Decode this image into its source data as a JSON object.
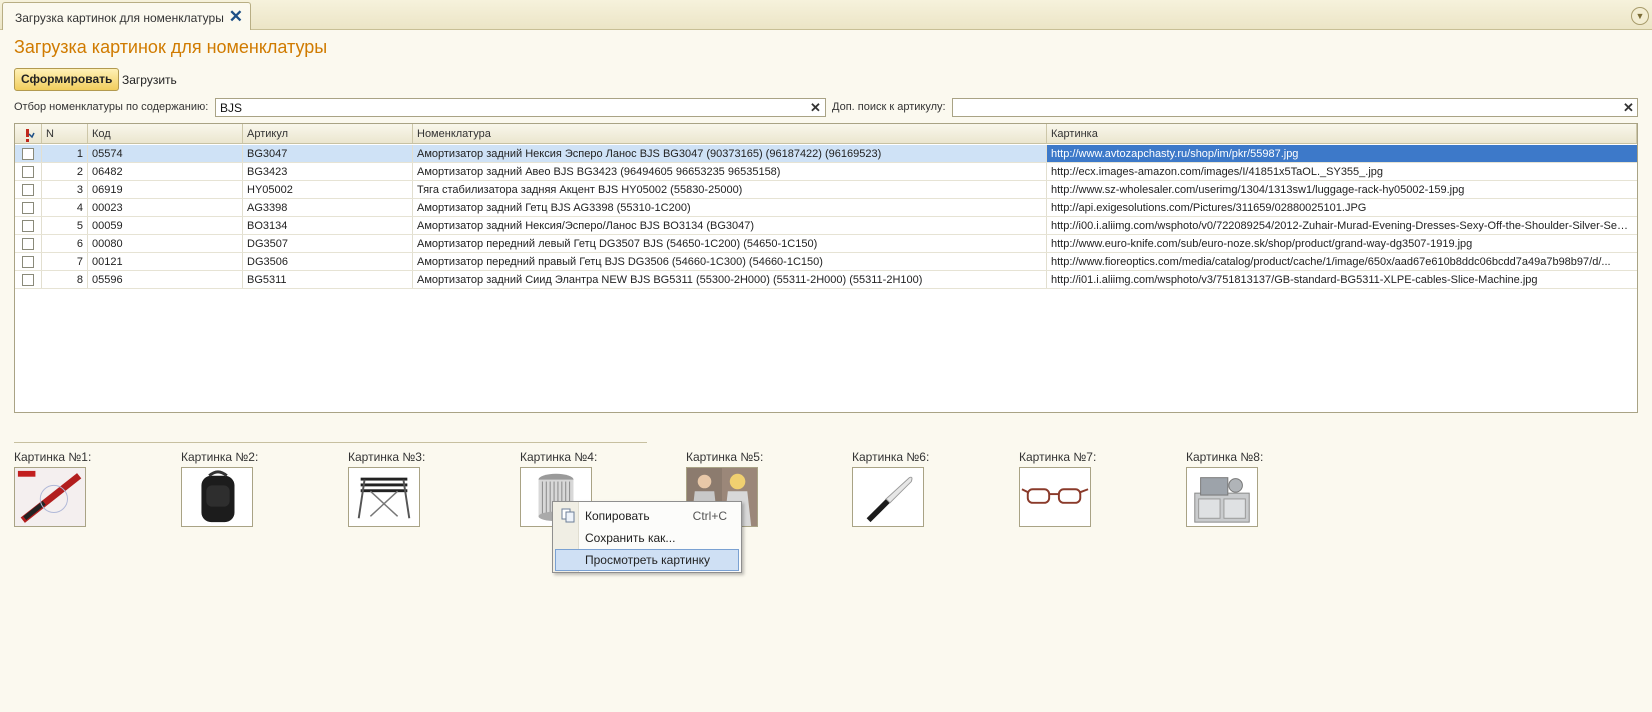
{
  "tab": {
    "title": "Загрузка картинок для номенклатуры"
  },
  "page": {
    "title": "Загрузка картинок для номенклатуры"
  },
  "toolbar": {
    "form_label": "Сформировать",
    "load_label": "Загрузить"
  },
  "filter": {
    "content_label": "Отбор номенклатуры по содержанию:",
    "content_value": "BJS",
    "article_label": "Доп. поиск к артикулу:",
    "article_value": ""
  },
  "table": {
    "columns": {
      "n": "N",
      "kod": "Код",
      "art": "Артикул",
      "nom": "Номенклатура",
      "img": "Картинка"
    },
    "rows": [
      {
        "n": "1",
        "kod": "05574",
        "art": "BG3047",
        "nom": "Амортизатор задний Нексия Эсперо Ланос BJS BG3047 (90373165) (96187422) (96169523)",
        "img": "http://www.avtozapchasty.ru/shop/im/pkr/55987.jpg"
      },
      {
        "n": "2",
        "kod": "06482",
        "art": "BG3423",
        "nom": "Амортизатор задний Авео BJS BG3423 (96494605 96653235 96535158)",
        "img": "http://ecx.images-amazon.com/images/I/41851x5TaOL._SY355_.jpg"
      },
      {
        "n": "3",
        "kod": "06919",
        "art": "HY05002",
        "nom": "Тяга стабилизатора задняя Акцент BJS HY05002 (55830-25000)",
        "img": "http://www.sz-wholesaler.com/userimg/1304/1313sw1/luggage-rack-hy05002-159.jpg"
      },
      {
        "n": "4",
        "kod": "00023",
        "art": "AG3398",
        "nom": "Амортизатор задний Гетц BJS AG3398 (55310-1C200)",
        "img": "http://api.exigesolutions.com/Pictures/311659/02880025101.JPG"
      },
      {
        "n": "5",
        "kod": "00059",
        "art": "BO3134",
        "nom": "Амортизатор задний Нексия/Эсперо/Ланос BJS BO3134 (BG3047)",
        "img": "http://i00.i.aliimg.com/wsphoto/v0/722089254/2012-Zuhair-Murad-Evening-Dresses-Sexy-Off-the-Shoulder-Silver-Sequi..."
      },
      {
        "n": "6",
        "kod": "00080",
        "art": "DG3507",
        "nom": "Амортизатор передний левый Гетц DG3507 BJS (54650-1C200) (54650-1C150)",
        "img": "http://www.euro-knife.com/sub/euro-noze.sk/shop/product/grand-way-dg3507-1919.jpg"
      },
      {
        "n": "7",
        "kod": "00121",
        "art": "DG3506",
        "nom": "Амортизатор передний правый Гетц BJS DG3506 (54660-1C300) (54660-1C150)",
        "img": "http://www.fioreoptics.com/media/catalog/product/cache/1/image/650x/aad67e610b8ddc06bcdd7a49a7b98b97/d/..."
      },
      {
        "n": "8",
        "kod": "05596",
        "art": "BG5311",
        "nom": "Амортизатор задний Сиид Элантра NEW BJS BG5311 (55300-2H000) (55311-2H000) (55311-2H100)",
        "img": "http://i01.i.aliimg.com/wsphoto/v3/751813137/GB-standard-BG5311-XLPE-cables-Slice-Machine.jpg"
      }
    ]
  },
  "pictures": [
    {
      "label": "Картинка №1:",
      "icon": "pen-image"
    },
    {
      "label": "Картинка №2:",
      "icon": "backpack-image"
    },
    {
      "label": "Картинка №3:",
      "icon": "luggage-rack-image"
    },
    {
      "label": "Картинка №4:",
      "icon": "filter-image"
    },
    {
      "label": "Картинка №5:",
      "icon": "dress-photo-image"
    },
    {
      "label": "Картинка №6:",
      "icon": "knife-image"
    },
    {
      "label": "Картинка №7:",
      "icon": "glasses-image"
    },
    {
      "label": "Картинка №8:",
      "icon": "machine-image"
    }
  ],
  "context_menu": {
    "copy": {
      "label": "Копировать",
      "shortcut": "Ctrl+C"
    },
    "save": {
      "label": "Сохранить как..."
    },
    "view": {
      "label": "Просмотреть картинку"
    }
  },
  "colors": {
    "title": "#d07b00",
    "selected_row": "#cfe2f6",
    "selected_cell": "#3d79c9",
    "form_button": "#f1cd5d"
  }
}
